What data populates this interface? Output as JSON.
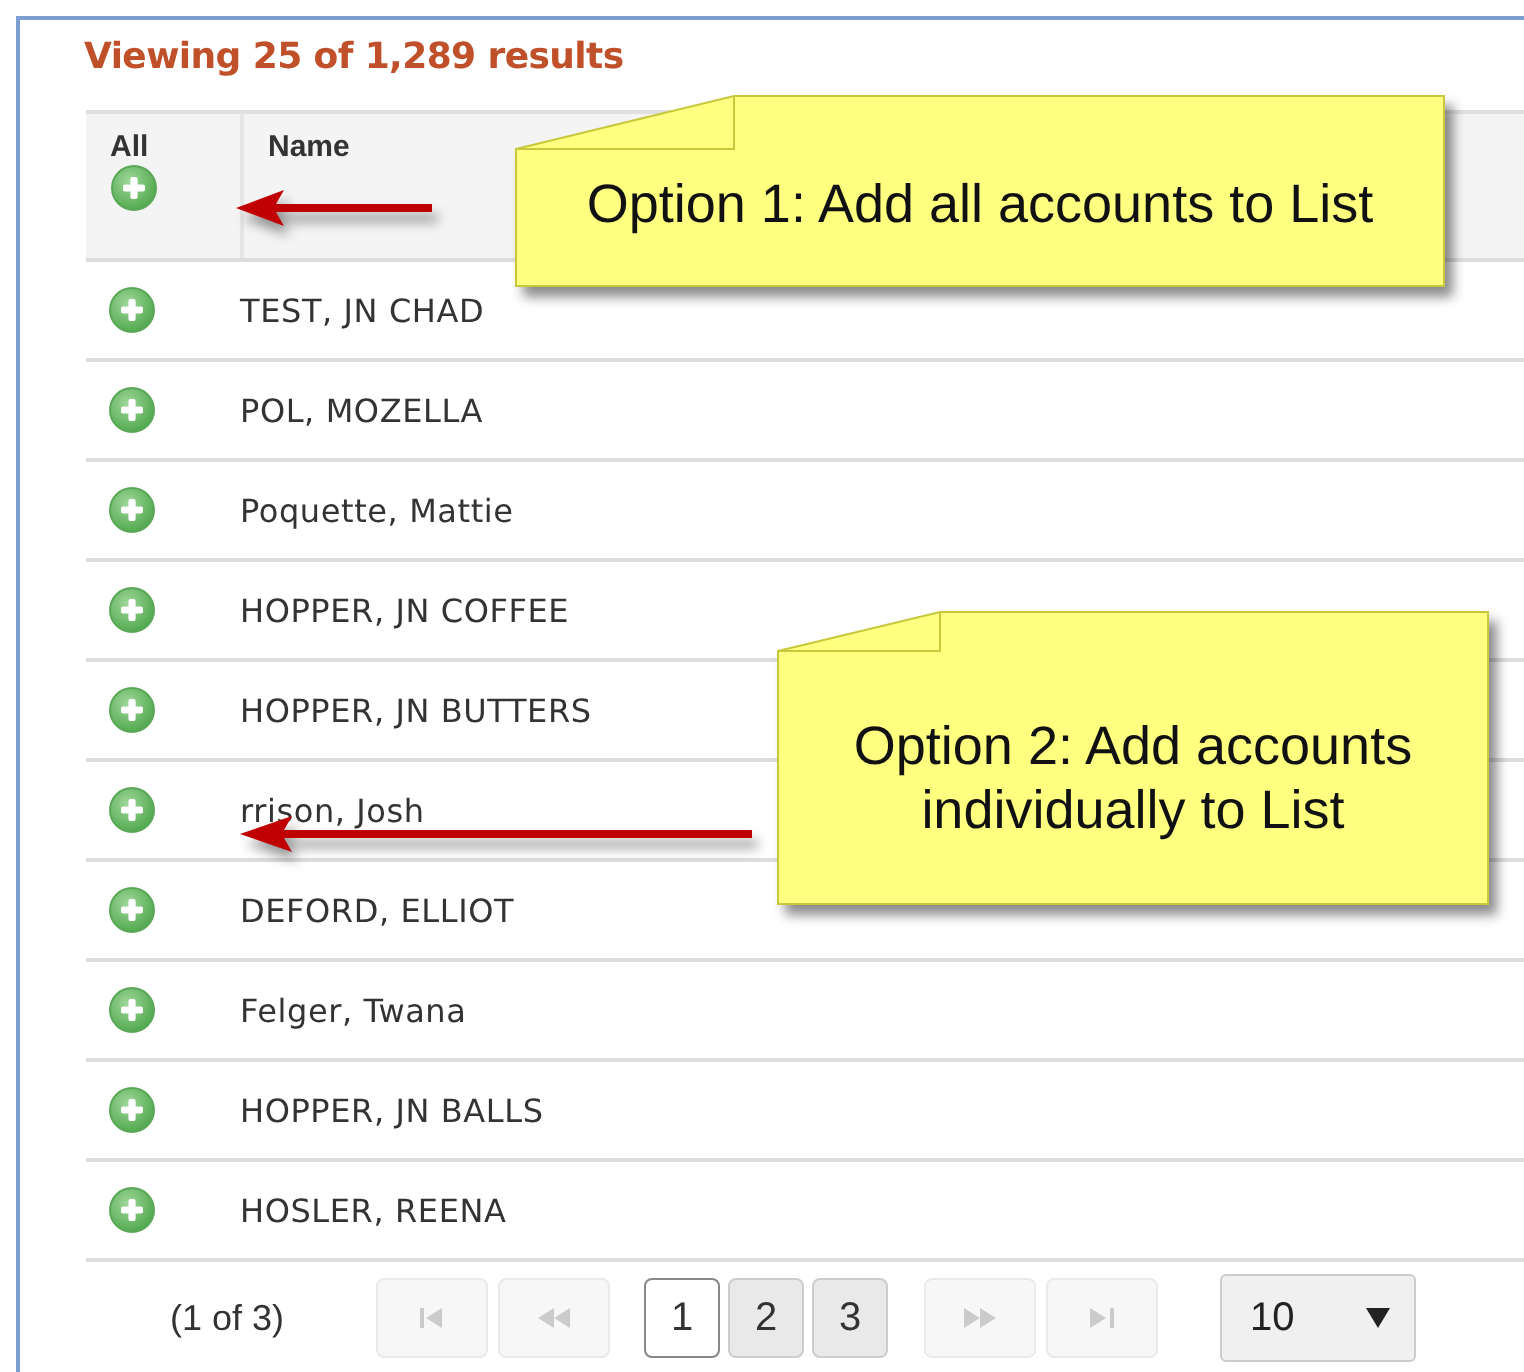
{
  "summary": "Viewing 25 of 1,289 results",
  "table": {
    "columns": [
      {
        "label": "All"
      },
      {
        "label": "Name"
      }
    ],
    "rows": [
      {
        "name": "TEST, JN CHAD"
      },
      {
        "name": "POL, MOZELLA"
      },
      {
        "name": "Poquette, Mattie"
      },
      {
        "name": "HOPPER, JN COFFEE"
      },
      {
        "name": "HOPPER, JN BUTTERS"
      },
      {
        "name": "rrison, Josh"
      },
      {
        "name": "DEFORD, ELLIOT"
      },
      {
        "name": "Felger, Twana"
      },
      {
        "name": "HOPPER, JN BALLS"
      },
      {
        "name": "HOSLER, REENA"
      }
    ]
  },
  "pagination": {
    "status": "(1 of 3)",
    "nav_before": [
      {
        "kind": "first",
        "disabled": true
      },
      {
        "kind": "prev",
        "disabled": true
      }
    ],
    "pages": [
      {
        "label": "1",
        "selected": true
      },
      {
        "label": "2",
        "selected": false
      },
      {
        "label": "3",
        "selected": false
      }
    ],
    "nav_after": [
      {
        "kind": "next",
        "disabled": true
      },
      {
        "kind": "last",
        "disabled": true
      }
    ],
    "page_size": "10"
  },
  "callouts": [
    {
      "text": "Option 1: Add all accounts to List"
    },
    {
      "text": "Option 2: Add accounts individually to List"
    }
  ]
}
